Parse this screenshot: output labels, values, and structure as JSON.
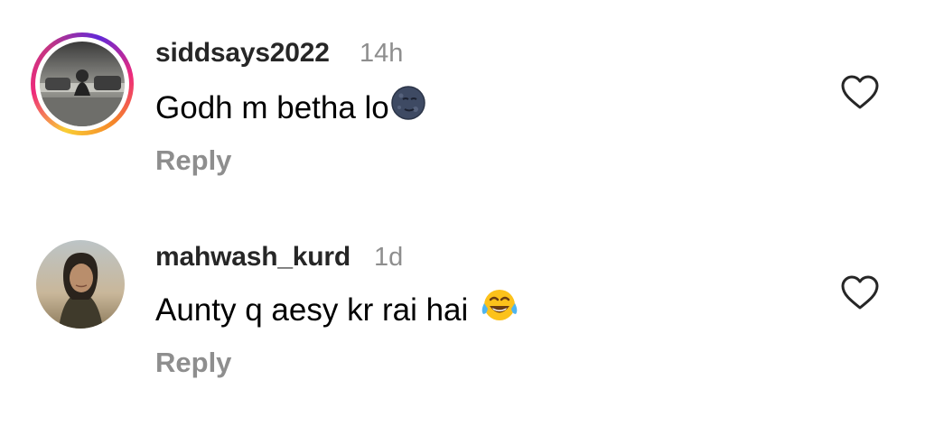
{
  "comments": [
    {
      "username": "siddsays2022",
      "time": "14h",
      "text": "Godh m betha lo",
      "emoji_icon": "new-moon-face-icon",
      "reply_label": "Reply",
      "has_story_ring": true
    },
    {
      "username": "mahwash_kurd",
      "time": "1d",
      "text": "Aunty q aesy kr rai hai ",
      "emoji_icon": "face-with-tears-of-joy-icon",
      "reply_label": "Reply",
      "has_story_ring": false
    }
  ],
  "colors": {
    "username": "#262626",
    "secondary": "#8e8e8e",
    "story_ring": [
      "#f9ce34",
      "#ee2a7b",
      "#6228d7"
    ]
  }
}
